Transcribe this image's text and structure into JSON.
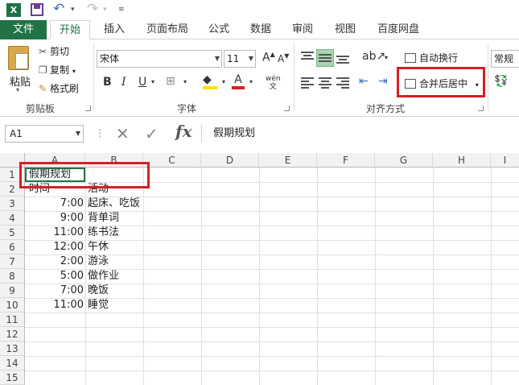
{
  "qat": {
    "excel_icon": "X"
  },
  "tabs": [
    "文件",
    "开始",
    "插入",
    "页面布局",
    "公式",
    "数据",
    "审阅",
    "视图",
    "百度网盘"
  ],
  "clipboard": {
    "paste": "粘贴",
    "cut": "剪切",
    "copy": "复制",
    "format_painter": "格式刷",
    "group": "剪贴板"
  },
  "font": {
    "name": "宋体",
    "size": "11",
    "grow": "A",
    "shrink": "A",
    "bold": "B",
    "italic": "I",
    "underline": "U",
    "phonetic": "wén",
    "group": "字体"
  },
  "alignment": {
    "wrap": "自动换行",
    "merge": "合并后居中",
    "group": "对齐方式"
  },
  "number": {
    "format": "常规"
  },
  "formula_bar": {
    "name_box": "A1",
    "fx": "fx",
    "content": "假期规划"
  },
  "columns": [
    "A",
    "B",
    "C",
    "D",
    "E",
    "F",
    "G",
    "H"
  ],
  "rows": [
    "1",
    "2",
    "3",
    "4",
    "5",
    "6",
    "7",
    "8",
    "9",
    "10",
    "11",
    "12",
    "13",
    "14",
    "15"
  ],
  "sheet": {
    "title": "假期规划",
    "header_a": "时间",
    "header_b": "活动",
    "entries": [
      {
        "time": "7:00",
        "activity": "起床、吃饭"
      },
      {
        "time": "9:00",
        "activity": "背单词"
      },
      {
        "time": "11:00",
        "activity": "练书法"
      },
      {
        "time": "12:00",
        "activity": "午休"
      },
      {
        "time": "2:00",
        "activity": "游泳"
      },
      {
        "time": "5:00",
        "activity": "做作业"
      },
      {
        "time": "7:00",
        "activity": "晚饭"
      },
      {
        "time": "11:00",
        "activity": "睡觉"
      }
    ]
  },
  "colors": {
    "accent": "#217346",
    "highlight": "#d71f25"
  }
}
